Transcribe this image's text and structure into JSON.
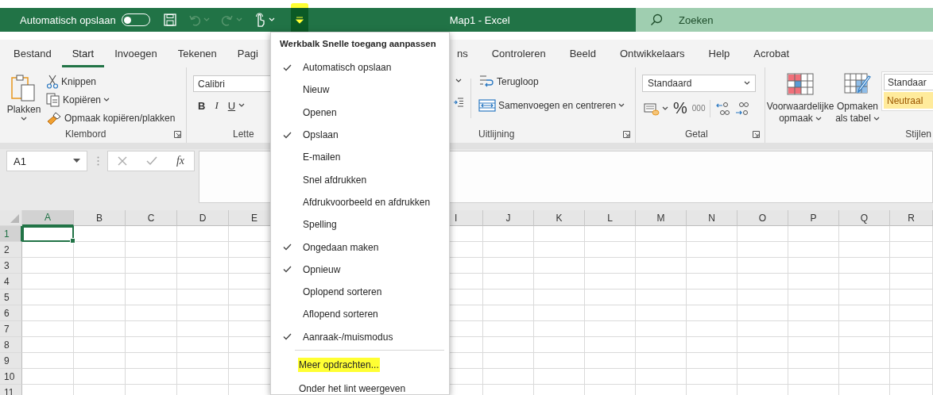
{
  "title_bar": {
    "autosave_label": "Automatisch opslaan",
    "autosave_on": false,
    "quick_access": [
      {
        "kind": "save",
        "disabled": false,
        "dropdown": false,
        "highlighted": false
      },
      {
        "kind": "undo",
        "disabled": true,
        "dropdown": true,
        "highlighted": false
      },
      {
        "kind": "redo",
        "disabled": true,
        "dropdown": true,
        "highlighted": false
      },
      {
        "kind": "touch",
        "disabled": false,
        "dropdown": true,
        "highlighted": false
      },
      {
        "kind": "customize",
        "disabled": false,
        "dropdown": false,
        "highlighted": true
      }
    ],
    "title": "Map1 - Excel",
    "search": {
      "placeholder": "Zoeken"
    }
  },
  "tabs": [
    {
      "label": "Bestand",
      "selected": false
    },
    {
      "label": "Start",
      "selected": true
    },
    {
      "label": "Invoegen",
      "selected": false
    },
    {
      "label": "Tekenen",
      "selected": false
    },
    {
      "label": "Pagi",
      "selected": false
    },
    {
      "label": "ns",
      "selected": false
    },
    {
      "label": "Controleren",
      "selected": false
    },
    {
      "label": "Beeld",
      "selected": false
    },
    {
      "label": "Ontwikkelaars",
      "selected": false
    },
    {
      "label": "Help",
      "selected": false
    },
    {
      "label": "Acrobat",
      "selected": false
    }
  ],
  "ribbon": {
    "groups": [
      {
        "kind": "clipboard",
        "label": "Klembord",
        "launcher": true,
        "paste_label": "Plakken",
        "commands": [
          {
            "label": "Knippen",
            "dropdown": false
          },
          {
            "label": "Kopiëren",
            "dropdown": true
          },
          {
            "label": "Opmaak kopiëren/plakken",
            "dropdown": false
          }
        ]
      },
      {
        "kind": "font",
        "label": "Lette",
        "launcher": false,
        "font_name": "Calibri",
        "format_buttons": [
          {
            "kind": "bold",
            "label": "B",
            "dropdown": false
          },
          {
            "kind": "italic",
            "label": "I",
            "dropdown": false
          },
          {
            "kind": "underline",
            "label": "U",
            "dropdown": true
          }
        ]
      },
      {
        "kind": "alignment",
        "label": "Uitlijning",
        "launcher": true,
        "commands": [
          {
            "label": "Terugloop",
            "dropdown": false
          },
          {
            "label": "Samenvoegen en centreren",
            "dropdown": true
          }
        ]
      },
      {
        "kind": "number",
        "label": "Getal",
        "launcher": true,
        "format": "Standaard",
        "percent": "%",
        "thousands": "000"
      },
      {
        "kind": "styles",
        "label": "Stijlen",
        "launcher": false,
        "commands": [
          {
            "label": "Voorwaardelijke opmaak",
            "dropdown": true
          },
          {
            "label": "Opmaken als tabel",
            "dropdown": true
          }
        ],
        "gallery": [
          {
            "kind": "normal",
            "label": "Standaar"
          },
          {
            "kind": "neutral",
            "label": "Neutraal"
          }
        ]
      }
    ]
  },
  "formula_bar": {
    "name_box": "A1",
    "insert_function": "fx"
  },
  "sheet": {
    "columns": [
      {
        "label": "A",
        "selected": true
      },
      {
        "label": "B",
        "selected": false
      },
      {
        "label": "C",
        "selected": false
      },
      {
        "label": "D",
        "selected": false
      },
      {
        "label": "E",
        "selected": false
      },
      {
        "label": "I",
        "selected": false
      },
      {
        "label": "J",
        "selected": false
      },
      {
        "label": "K",
        "selected": false
      },
      {
        "label": "L",
        "selected": false
      },
      {
        "label": "M",
        "selected": false
      },
      {
        "label": "N",
        "selected": false
      },
      {
        "label": "O",
        "selected": false
      },
      {
        "label": "P",
        "selected": false
      },
      {
        "label": "Q",
        "selected": false
      },
      {
        "label": "R",
        "selected": false
      }
    ],
    "rows": [
      {
        "label": "1",
        "selected": true
      },
      {
        "label": "2",
        "selected": false
      },
      {
        "label": "3",
        "selected": false
      },
      {
        "label": "4",
        "selected": false
      },
      {
        "label": "5",
        "selected": false
      },
      {
        "label": "6",
        "selected": false
      },
      {
        "label": "7",
        "selected": false
      },
      {
        "label": "8",
        "selected": false
      },
      {
        "label": "9",
        "selected": false
      },
      {
        "label": "10",
        "selected": false
      },
      {
        "label": "11",
        "selected": false
      }
    ]
  },
  "quick_access_menu": {
    "title": "Werkbalk Snelle toegang aanpassen",
    "items": [
      {
        "label": "Automatisch opslaan",
        "checked": true
      },
      {
        "label": "Nieuw",
        "checked": false
      },
      {
        "label": "Openen",
        "checked": false
      },
      {
        "label": "Opslaan",
        "checked": true
      },
      {
        "label": "E-mailen",
        "checked": false
      },
      {
        "label": "Snel afdrukken",
        "checked": false
      },
      {
        "label": "Afdrukvoorbeeld en afdrukken",
        "checked": false
      },
      {
        "label": "Spelling",
        "checked": false
      },
      {
        "label": "Ongedaan maken",
        "checked": true
      },
      {
        "label": "Opnieuw",
        "checked": true
      },
      {
        "label": "Oplopend sorteren",
        "checked": false
      },
      {
        "label": "Aflopend sorteren",
        "checked": false
      },
      {
        "label": "Aanraak-/muismodus",
        "checked": true
      }
    ],
    "more_items": [
      {
        "label": "Meer opdrachten...",
        "highlighted": true
      },
      {
        "label": "Onder het lint weergeven",
        "highlighted": false
      }
    ]
  }
}
